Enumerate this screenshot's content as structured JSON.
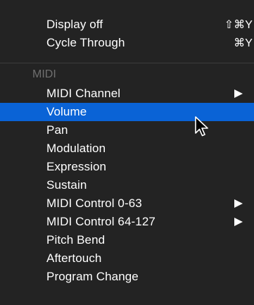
{
  "top_items": [
    {
      "label": "Display off",
      "shortcut": "⇧⌘Y"
    },
    {
      "label": "Cycle Through",
      "shortcut": "⌘Y"
    }
  ],
  "section_header": "MIDI",
  "midi_items": [
    {
      "label": "MIDI Channel",
      "submenu": true,
      "selected": false
    },
    {
      "label": "Volume",
      "submenu": false,
      "selected": true
    },
    {
      "label": "Pan",
      "submenu": false,
      "selected": false
    },
    {
      "label": "Modulation",
      "submenu": false,
      "selected": false
    },
    {
      "label": "Expression",
      "submenu": false,
      "selected": false
    },
    {
      "label": "Sustain",
      "submenu": false,
      "selected": false
    },
    {
      "label": "MIDI Control 0-63",
      "submenu": true,
      "selected": false
    },
    {
      "label": "MIDI Control 64-127",
      "submenu": true,
      "selected": false
    },
    {
      "label": "Pitch Bend",
      "submenu": false,
      "selected": false
    },
    {
      "label": "Aftertouch",
      "submenu": false,
      "selected": false
    },
    {
      "label": "Program Change",
      "submenu": false,
      "selected": false
    }
  ],
  "colors": {
    "background": "#232323",
    "selection": "#0a63d6",
    "text": "#ffffff",
    "section_header": "#6f6f6f"
  },
  "icons": {
    "submenu": "submenu-arrow-icon",
    "pointer": "mouse-pointer-icon"
  }
}
